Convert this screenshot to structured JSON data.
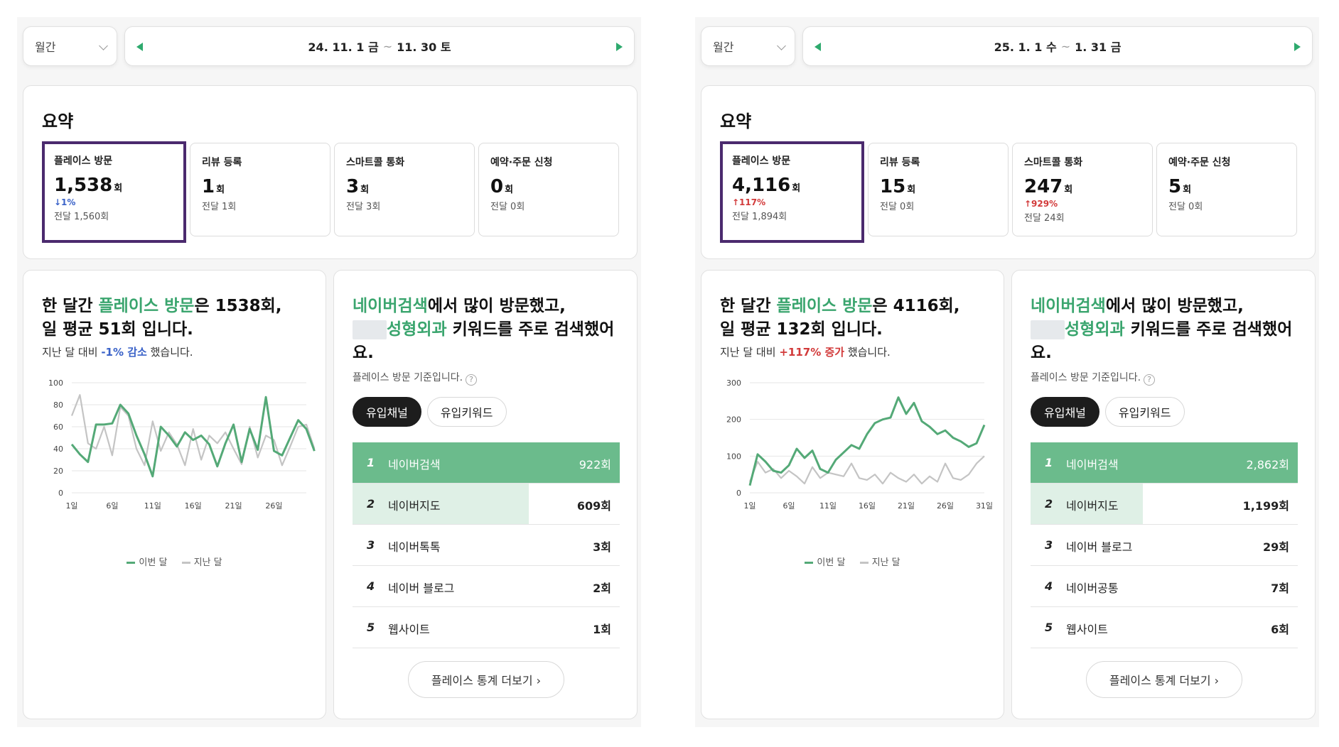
{
  "colors": {
    "accent": "#3aa56e",
    "this_month_line": "#54a977",
    "last_month_line": "#c4c4c4",
    "bar_first": "#6bbb8c",
    "bar": "#dff0e6",
    "selected_border": "#4b2a6e",
    "down": "#3a62c8",
    "up": "#d23a3a"
  },
  "left": {
    "period": "월간",
    "date_start": "24. 11. 1 금",
    "date_sep": "~",
    "date_end": "11. 30 토",
    "summary_title": "요약",
    "stats": [
      {
        "label": "플레이스 방문",
        "value": "1,538",
        "unit": "회",
        "change": "↓1%",
        "prev": "전달 1,560회"
      },
      {
        "label": "리뷰 등록",
        "value": "1",
        "unit": "회",
        "change": "",
        "prev": "전달 1회"
      },
      {
        "label": "스마트콜 통화",
        "value": "3",
        "unit": "회",
        "change": "",
        "prev": "전달 3회"
      },
      {
        "label": "예약·주문 신청",
        "value": "0",
        "unit": "회",
        "change": "",
        "prev": "전달 0회"
      }
    ],
    "trend": {
      "h1": "한 달간 ",
      "h2": "플레이스 방문",
      "h3": "은 1538회,",
      "h4": "일 평균 51회 입니다.",
      "s1": "지난 달 대비 ",
      "s2": "-1% 감소",
      "s3": " 했습니다."
    },
    "channel": {
      "h1": "네이버검색",
      "h2": "에서 많이 방문했고,",
      "h3": "성형외과",
      "h4": " 키워드를 주로 검색했어요.",
      "note": "플레이스 방문 기준입니다.",
      "help": "?",
      "tab1": "유입채널",
      "tab2": "유입키워드",
      "more": "플레이스 통계 더보기 ›"
    },
    "ranks": [
      {
        "num": "1",
        "name": "네이버검색",
        "count": "922회",
        "share": 1.0
      },
      {
        "num": "2",
        "name": "네이버지도",
        "count": "609회",
        "share": 0.66
      },
      {
        "num": "3",
        "name": "네이버톡톡",
        "count": "3회",
        "share": 0.0
      },
      {
        "num": "4",
        "name": "네이버 블로그",
        "count": "2회",
        "share": 0.0
      },
      {
        "num": "5",
        "name": "웹사이트",
        "count": "1회",
        "share": 0.0
      }
    ],
    "legend": {
      "this": "이번 달",
      "last": "지난 달"
    }
  },
  "right": {
    "period": "월간",
    "date_start": "25. 1. 1 수",
    "date_sep": "~",
    "date_end": "1. 31 금",
    "summary_title": "요약",
    "stats": [
      {
        "label": "플레이스 방문",
        "value": "4,116",
        "unit": "회",
        "change": "↑117%",
        "prev": "전달 1,894회"
      },
      {
        "label": "리뷰 등록",
        "value": "15",
        "unit": "회",
        "change": "",
        "prev": "전달 0회"
      },
      {
        "label": "스마트콜 통화",
        "value": "247",
        "unit": "회",
        "change": "↑929%",
        "prev": "전달 24회"
      },
      {
        "label": "예약·주문 신청",
        "value": "5",
        "unit": "회",
        "change": "",
        "prev": "전달 0회"
      }
    ],
    "trend": {
      "h1": "한 달간 ",
      "h2": "플레이스 방문",
      "h3": "은 4116회,",
      "h4": "일 평균 132회 입니다.",
      "s1": "지난 달 대비 ",
      "s2": "+117% 증가",
      "s3": " 했습니다."
    },
    "channel": {
      "h1": "네이버검색",
      "h2": "에서 많이 방문했고,",
      "h3": "성형외과",
      "h4": " 키워드를 주로 검색했어요.",
      "note": "플레이스 방문 기준입니다.",
      "help": "?",
      "tab1": "유입채널",
      "tab2": "유입키워드",
      "more": "플레이스 통계 더보기 ›"
    },
    "ranks": [
      {
        "num": "1",
        "name": "네이버검색",
        "count": "2,862회",
        "share": 1.0
      },
      {
        "num": "2",
        "name": "네이버지도",
        "count": "1,199회",
        "share": 0.42
      },
      {
        "num": "3",
        "name": "네이버 블로그",
        "count": "29회",
        "share": 0.0
      },
      {
        "num": "4",
        "name": "네이버공통",
        "count": "7회",
        "share": 0.0
      },
      {
        "num": "5",
        "name": "웹사이트",
        "count": "6회",
        "share": 0.0
      }
    ],
    "legend": {
      "this": "이번 달",
      "last": "지난 달"
    }
  },
  "chart_data": [
    {
      "type": "line",
      "x_ticks": [
        "1일",
        "6일",
        "11일",
        "16일",
        "21일",
        "26일"
      ],
      "y_ticks": [
        0,
        20,
        40,
        60,
        80,
        100
      ],
      "ylim": [
        0,
        100
      ],
      "x_count": 30,
      "series": [
        {
          "name": "이번 달",
          "values": [
            44,
            35,
            28,
            62,
            62,
            63,
            80,
            72,
            52,
            35,
            15,
            60,
            52,
            42,
            55,
            48,
            52,
            44,
            24,
            45,
            62,
            28,
            58,
            39,
            87,
            38,
            34,
            50,
            66,
            58,
            38
          ]
        },
        {
          "name": "지난 달",
          "values": [
            70,
            89,
            45,
            40,
            60,
            34,
            78,
            70,
            40,
            25,
            65,
            38,
            55,
            44,
            25,
            58,
            30,
            52,
            45,
            55,
            40,
            26,
            60,
            32,
            52,
            48,
            25,
            42,
            60,
            62,
            40
          ]
        }
      ]
    },
    {
      "type": "line",
      "x_ticks": [
        "1일",
        "6일",
        "11일",
        "16일",
        "21일",
        "26일",
        "31일"
      ],
      "y_ticks": [
        0,
        100,
        200,
        300
      ],
      "ylim": [
        0,
        300
      ],
      "x_count": 31,
      "series": [
        {
          "name": "이번 달",
          "values": [
            20,
            105,
            85,
            60,
            55,
            75,
            120,
            95,
            115,
            65,
            55,
            90,
            110,
            130,
            120,
            160,
            190,
            200,
            205,
            260,
            215,
            245,
            195,
            180,
            160,
            170,
            150,
            140,
            125,
            135,
            185
          ]
        },
        {
          "name": "지난 달",
          "values": [
            30,
            85,
            55,
            65,
            40,
            60,
            45,
            25,
            70,
            40,
            55,
            50,
            45,
            80,
            40,
            35,
            50,
            25,
            55,
            40,
            30,
            50,
            25,
            45,
            30,
            80,
            40,
            35,
            50,
            80,
            100
          ]
        }
      ]
    }
  ]
}
